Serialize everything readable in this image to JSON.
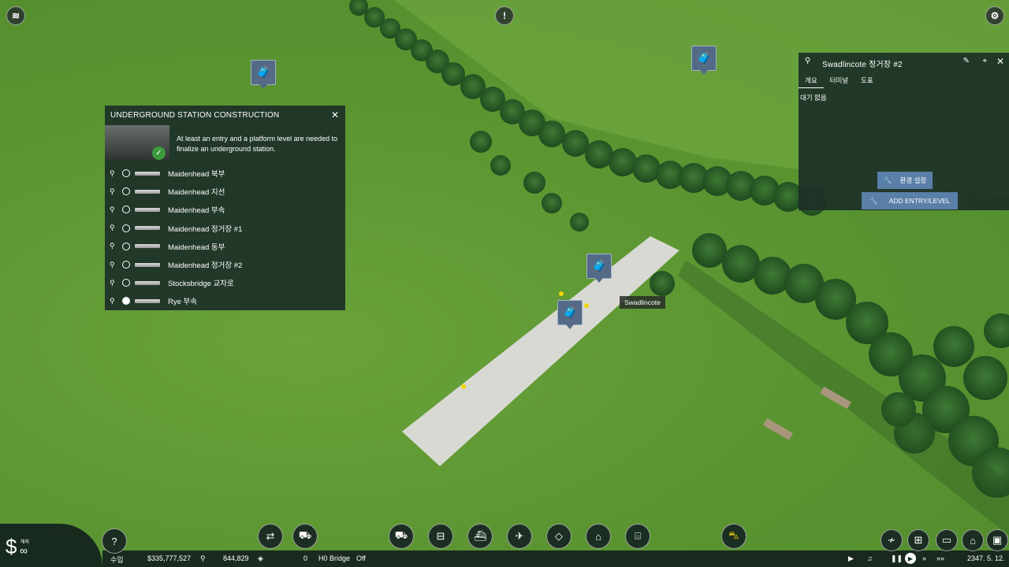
{
  "construction_panel": {
    "title": "UNDERGROUND STATION CONSTRUCTION",
    "description": "At least an entry and a platform level are needed to finalize an underground station.",
    "stations": [
      {
        "name": "Maidenhead 북부",
        "checked": false
      },
      {
        "name": "Maidenhead 지선",
        "checked": false
      },
      {
        "name": "Maidenhead 부속",
        "checked": false
      },
      {
        "name": "Maidenhead 정거장 #1",
        "checked": false
      },
      {
        "name": "Maidenhead 동부",
        "checked": false
      },
      {
        "name": "Maidenhead 정거장 #2",
        "checked": false
      },
      {
        "name": "Stocksbridge 교차로",
        "checked": false
      },
      {
        "name": "Rye 부속",
        "checked": true
      }
    ]
  },
  "station_panel": {
    "title": "Swadlincote 정거장 #2",
    "tabs": [
      "개요",
      "터미널",
      "도표"
    ],
    "status": "대기 없음",
    "settings_button": "환경 설정",
    "add_entry_button": "ADD ENTRY/LEVEL"
  },
  "map": {
    "tooltip": "Swadlincote"
  },
  "status_bar": {
    "income_label": "수입",
    "money": "$335,777,527",
    "population": "844,829",
    "cargo": "0",
    "bridge_label": "H0 Bridge",
    "bridge_state": "Off",
    "date": "2347. 5. 12.",
    "money_symbol": "$",
    "money_sub": "∞",
    "money_tag": "해외"
  },
  "colors": {
    "panel_bg": "#1c3028",
    "button": "#5a7fa8",
    "grass": "#5c9632"
  }
}
